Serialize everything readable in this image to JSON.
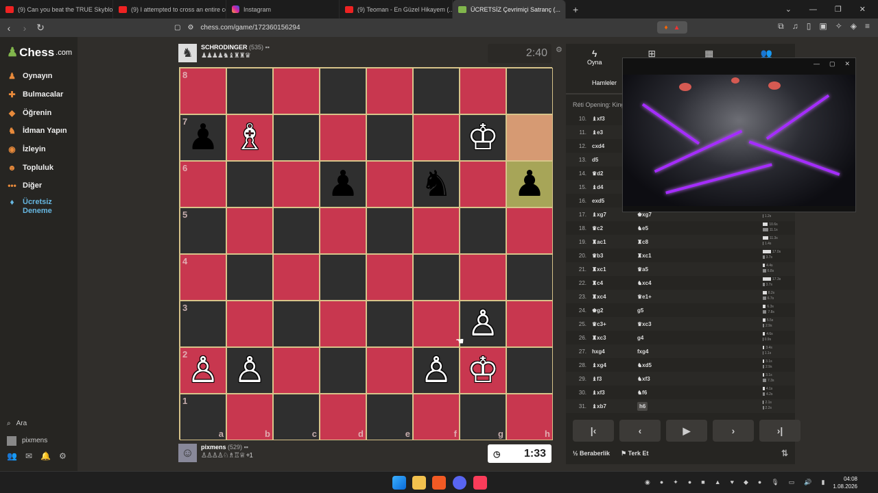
{
  "browser": {
    "tabs": [
      {
        "title": "(9) Can you beat the TRUE Skyblock?",
        "icon": "youtube-icon"
      },
      {
        "title": "(9) I attempted to cross an entire co...",
        "icon": "youtube-icon"
      },
      {
        "title": "Instagram",
        "icon": "instagram-icon"
      },
      {
        "title": "(9) Teoman - En Güzel Hikayem (...",
        "icon": "youtube-icon"
      },
      {
        "title": "ÜCRETSİZ Çevrimiçi Satranç (...",
        "icon": "chess-icon",
        "active": true
      }
    ],
    "url": "chess.com/game/172360156294",
    "brave_badge": "4"
  },
  "sidebar": {
    "logo": "Chess",
    "logo_suffix": ".com",
    "items": [
      {
        "label": "Oynayın",
        "icon": "play-icon"
      },
      {
        "label": "Bulmacalar",
        "icon": "puzzle-icon"
      },
      {
        "label": "Öğrenin",
        "icon": "learn-icon"
      },
      {
        "label": "İdman Yapın",
        "icon": "train-icon"
      },
      {
        "label": "İzleyin",
        "icon": "watch-icon"
      },
      {
        "label": "Topluluk",
        "icon": "community-icon"
      },
      {
        "label": "Diğer",
        "icon": "more-icon"
      },
      {
        "label": "Ücretsiz Deneme",
        "icon": "diamond-icon"
      }
    ],
    "search": "Ara",
    "user": "pixmens",
    "notif_count": "1"
  },
  "top_player": {
    "name": "SCHRODINGER",
    "rating": "(535)",
    "captured": "♟♟♟♟♞♝♜♜♛",
    "clock": "2:40"
  },
  "bottom_player": {
    "name": "pixmens",
    "rating": "(529)",
    "captured": "♙♙♙♙♘♗♖♕",
    "plus": "+1",
    "clock": "1:33"
  },
  "board": {
    "ranks": [
      "8",
      "7",
      "6",
      "5",
      "4",
      "3",
      "2",
      "1"
    ],
    "files": [
      "a",
      "b",
      "c",
      "d",
      "e",
      "f",
      "g",
      "h"
    ],
    "pieces": [
      {
        "sq": "a7",
        "p": "♟",
        "c": "b"
      },
      {
        "sq": "b7",
        "p": "♗",
        "c": "w"
      },
      {
        "sq": "g7",
        "p": "♔",
        "c": "w"
      },
      {
        "sq": "d6",
        "p": "♟",
        "c": "b"
      },
      {
        "sq": "f6",
        "p": "♞",
        "c": "b"
      },
      {
        "sq": "h6",
        "p": "♟",
        "c": "b"
      },
      {
        "sq": "g3",
        "p": "♙",
        "c": "w"
      },
      {
        "sq": "a2",
        "p": "♙",
        "c": "w"
      },
      {
        "sq": "b2",
        "p": "♙",
        "c": "w"
      },
      {
        "sq": "f2",
        "p": "♙",
        "c": "w"
      },
      {
        "sq": "g2",
        "p": "♔",
        "c": "w"
      }
    ],
    "highlight_from": "h7",
    "highlight_to": "h6"
  },
  "panel": {
    "tabs": [
      {
        "label": "Oyna",
        "icon": "bolt-icon"
      },
      {
        "label": "",
        "icon": "plus-square-icon"
      },
      {
        "label": "",
        "icon": "board-icon"
      },
      {
        "label": "",
        "icon": "players-icon"
      }
    ],
    "subtab": "Hamleler",
    "opening": "Réti Opening: King..."
  },
  "moves": [
    {
      "n": "10.",
      "w": "♝xf3",
      "b": "",
      "tw": "",
      "tb": ""
    },
    {
      "n": "11.",
      "w": "♝e3",
      "b": "",
      "tw": "",
      "tb": ""
    },
    {
      "n": "12.",
      "w": "cxd4",
      "b": "",
      "tw": "",
      "tb": ""
    },
    {
      "n": "13.",
      "w": "d5",
      "b": "",
      "tw": "",
      "tb": ""
    },
    {
      "n": "14.",
      "w": "♛d2",
      "b": "",
      "tw": "",
      "tb": ""
    },
    {
      "n": "15.",
      "w": "♝d4",
      "b": "",
      "tw": "",
      "tb": ""
    },
    {
      "n": "16.",
      "w": "exd5",
      "b": "",
      "tw": "",
      "tb": ""
    },
    {
      "n": "17.",
      "w": "♝xg7",
      "b": "♚xg7",
      "tw": "",
      "tb": "1.2s"
    },
    {
      "n": "18.",
      "w": "♛c2",
      "b": "♞e5",
      "tw": "10.6s",
      "tb": "11.1s"
    },
    {
      "n": "19.",
      "w": "♜ac1",
      "b": "♜c8",
      "tw": "11.3s",
      "tb": "1.4s"
    },
    {
      "n": "20.",
      "w": "♛b3",
      "b": "♜xc1",
      "tw": "17.0s",
      "tb": "3.7s"
    },
    {
      "n": "21.",
      "w": "♜xc1",
      "b": "♛a5",
      "tw": "4.4s",
      "tb": "6.8s"
    },
    {
      "n": "22.",
      "w": "♜c4",
      "b": "♞xc4",
      "tw": "17.3s",
      "tb": "3.7s"
    },
    {
      "n": "23.",
      "w": "♜xc4",
      "b": "♛e1+",
      "tw": "8.2s",
      "tb": "6.7s"
    },
    {
      "n": "24.",
      "w": "♚g2",
      "b": "g5",
      "tw": "6.3s",
      "tb": "7.8s"
    },
    {
      "n": "25.",
      "w": "♛c3+",
      "b": "♛xc3",
      "tw": "5.5s",
      "tb": "2.9s"
    },
    {
      "n": "26.",
      "w": "♜xc3",
      "b": "g4",
      "tw": "4.6s",
      "tb": "0.9s"
    },
    {
      "n": "27.",
      "w": "hxg4",
      "b": "fxg4",
      "tw": "3.4s",
      "tb": "1.1s"
    },
    {
      "n": "28.",
      "w": "♝xg4",
      "b": "♞xd5",
      "tw": "3.1s",
      "tb": "2.9s"
    },
    {
      "n": "29.",
      "w": "♝f3",
      "b": "♞xf3",
      "tw": "3.1s",
      "tb": "7.3s"
    },
    {
      "n": "30.",
      "w": "♝xf3",
      "b": "♞f6",
      "tw": "4.1s",
      "tb": "4.2s"
    },
    {
      "n": "31.",
      "w": "♝xb7",
      "b": "h6",
      "tw": "2.1s",
      "tb": "2.2s"
    }
  ],
  "footer": {
    "draw": "Beraberlik",
    "resign": "Terk Et",
    "draw_icon": "½"
  },
  "taskbar": {
    "time": "04:08",
    "date": "1.08.2026"
  },
  "colors": {
    "light_square": "#c8374f",
    "dark_square": "#2f2f2f",
    "accent": "#81b64c"
  }
}
